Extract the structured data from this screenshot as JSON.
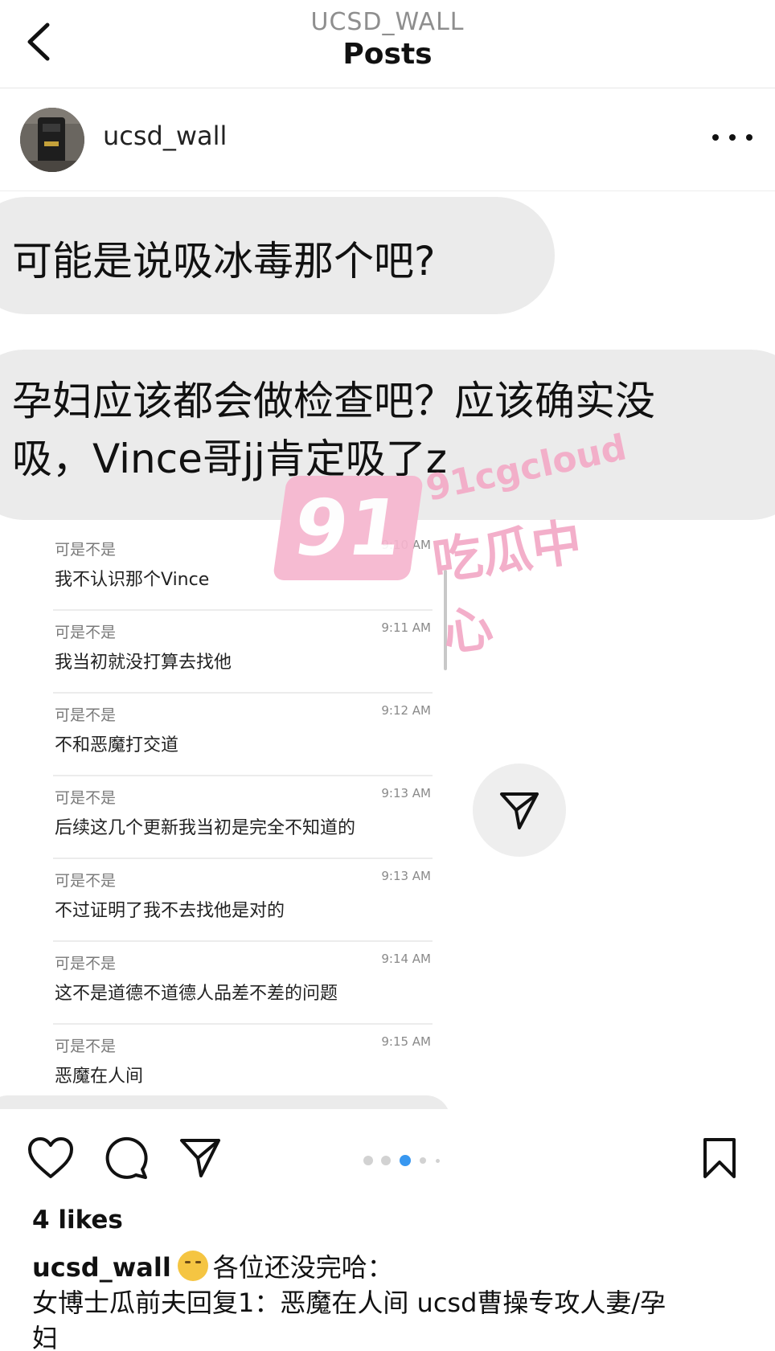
{
  "nav": {
    "account": "UCSD_WALL",
    "title": "Posts"
  },
  "post": {
    "username": "ucsd_wall",
    "avatar_icon": "avatar-photo"
  },
  "image": {
    "bubble1": "可能是说吸冰毒那个吧?",
    "bubble2_line1": "孕妇应该都会做检查吧？应该确实没",
    "bubble2_line2": "吸，Vince哥jj肯定吸了z",
    "chat": [
      {
        "sender": "可是不是",
        "time": "9:10 AM",
        "message": "我不认识那个Vince"
      },
      {
        "sender": "可是不是",
        "time": "9:11 AM",
        "message": "我当初就没打算去找他"
      },
      {
        "sender": "可是不是",
        "time": "9:12 AM",
        "message": "不和恶魔打交道"
      },
      {
        "sender": "可是不是",
        "time": "9:13 AM",
        "message": "后续这几个更新我当初是完全不知道的"
      },
      {
        "sender": "可是不是",
        "time": "9:13 AM",
        "message": "不过证明了我不去找他是对的"
      },
      {
        "sender": "可是不是",
        "time": "9:14 AM",
        "message": "这不是道德不道德人品差不差的问题"
      },
      {
        "sender": "可是不是",
        "time": "9:15 AM",
        "message": "恶魔在人间"
      }
    ],
    "watermark": {
      "number": "91",
      "domain": "91cgcloud",
      "brand": "吃瓜中心"
    }
  },
  "actions": {
    "icons": [
      "heart-icon",
      "comment-icon",
      "share-icon",
      "bookmark-icon"
    ],
    "carousel_total": 5,
    "carousel_active": 3,
    "accent": "#3897f0"
  },
  "likes": "4 likes",
  "caption": {
    "username": "ucsd_wall",
    "emoji": "face-with-steam-icon",
    "line1": "各位还没完哈：",
    "line2": "女博士瓜前夫回复1：恶魔在人间 ucsd曹操专攻人妻/孕",
    "line3": "妇"
  }
}
